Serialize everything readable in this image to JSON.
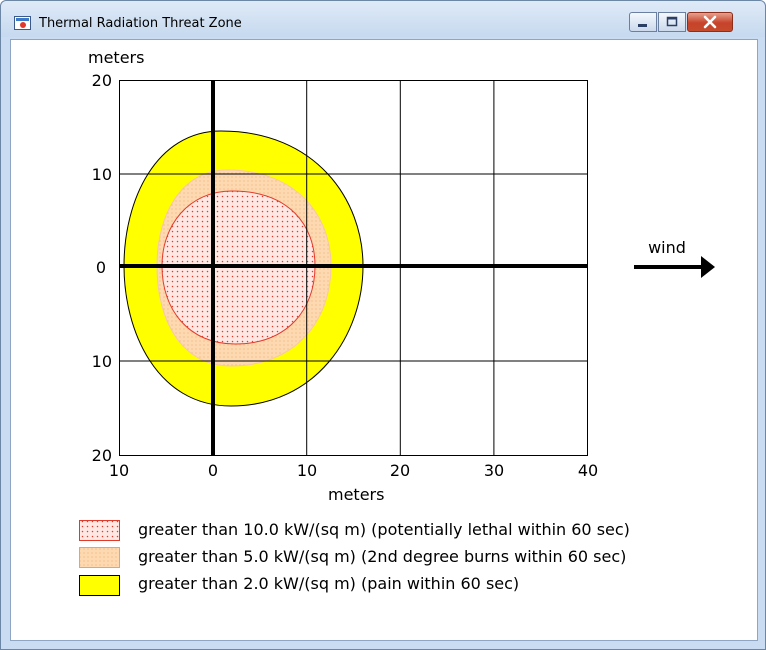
{
  "window": {
    "title": "Thermal Radiation Threat Zone",
    "minimize_label": "minimize",
    "maximize_label": "maximize",
    "close_label": "close"
  },
  "plot": {
    "y_unit_label": "meters",
    "x_unit_label": "meters",
    "y_tick_labels": [
      "20",
      "10",
      "0",
      "10",
      "20"
    ],
    "x_tick_labels": [
      "10",
      "0",
      "10",
      "20",
      "30",
      "40"
    ],
    "wind_label": "wind"
  },
  "legend": [
    {
      "text": "greater than 10.0 kW/(sq m) (potentially lethal within 60 sec)",
      "fill": "#ffe8e4",
      "dot_color": "#e23a2a",
      "border": "#e23a2a"
    },
    {
      "text": "greater than 5.0 kW/(sq m) (2nd degree burns within 60 sec)",
      "fill": "#fcd9b0",
      "dot_color": "#f3b079",
      "border": "#f0a060"
    },
    {
      "text": "greater than 2.0 kW/(sq m) (pain within 60 sec)",
      "fill": "#ffff00",
      "border": "#000000"
    }
  ],
  "colors": {
    "lethal_zone": "#ffe8e4",
    "lethal_dots": "#e23a2a",
    "burns_zone": "#fcd9b0",
    "pain_zone": "#ffff00",
    "frame": "#c9dcf1"
  },
  "chart_data": {
    "type": "threat-zone",
    "xlabel": "meters",
    "ylabel": "meters",
    "xlim": [
      -10,
      40
    ],
    "ylim": [
      -20,
      20
    ],
    "y_tick_values": [
      20,
      10,
      0,
      -10,
      -20
    ],
    "x_tick_values": [
      -10,
      0,
      10,
      20,
      30,
      40
    ],
    "grid": true,
    "zones": [
      {
        "name": "greater than 2.0 kW/(sq m) (pain within 60 sec)",
        "x_min": -9,
        "x_max": 16,
        "y_half_width": 14.5
      },
      {
        "name": "greater than 5.0 kW/(sq m) (2nd degree burns within 60 sec)",
        "x_min": -5.5,
        "x_max": 12.5,
        "y_half_width": 10.5
      },
      {
        "name": "greater than 10.0 kW/(sq m) (potentially lethal within 60 sec)",
        "x_min": -5,
        "x_max": 11,
        "y_half_width": 8
      }
    ]
  }
}
